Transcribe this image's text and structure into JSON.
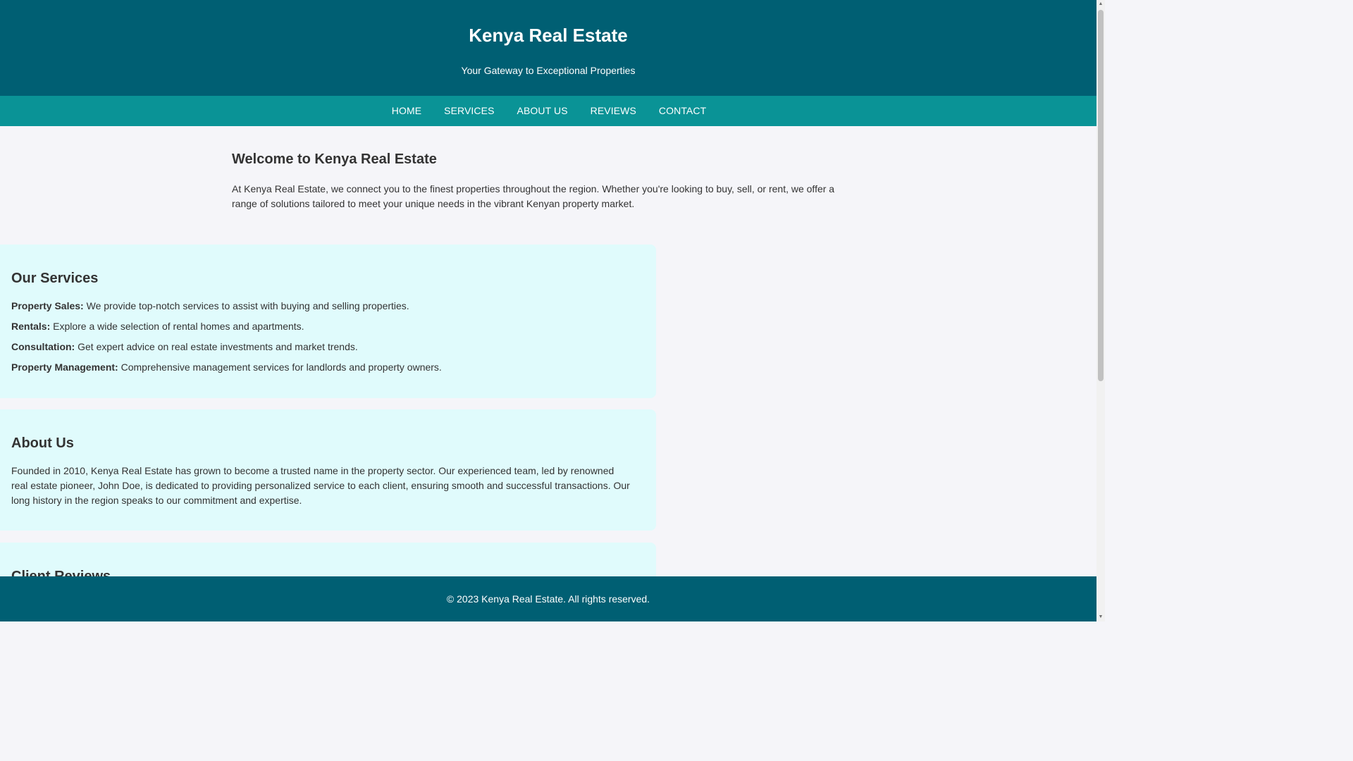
{
  "header": {
    "title": "Kenya Real Estate",
    "tagline": "Your Gateway to Exceptional Properties"
  },
  "nav": {
    "items": [
      {
        "label": "HOME"
      },
      {
        "label": "SERVICES"
      },
      {
        "label": "ABOUT US"
      },
      {
        "label": "REVIEWS"
      },
      {
        "label": "CONTACT"
      }
    ]
  },
  "welcome": {
    "heading": "Welcome to Kenya Real Estate",
    "text": "At Kenya Real Estate, we connect you to the finest properties throughout the region. Whether you're looking to buy, sell, or rent, we offer a range of solutions tailored to meet your unique needs in the vibrant Kenyan property market."
  },
  "services": {
    "heading": "Our Services",
    "items": [
      {
        "label": "Property Sales:",
        "text": " We provide top-notch services to assist with buying and selling properties."
      },
      {
        "label": "Rentals:",
        "text": " Explore a wide selection of rental homes and apartments."
      },
      {
        "label": "Consultation:",
        "text": " Get expert advice on real estate investments and market trends."
      },
      {
        "label": "Property Management:",
        "text": " Comprehensive management services for landlords and property owners."
      }
    ]
  },
  "about": {
    "heading": "About Us",
    "text": "Founded in 2010, Kenya Real Estate has grown to become a trusted name in the property sector. Our experienced team, led by renowned real estate pioneer, John Doe, is dedicated to providing personalized service to each client, ensuring smooth and successful transactions. Our long history in the region speaks to our commitment and expertise."
  },
  "reviews": {
    "heading": "Client Reviews"
  },
  "footer": {
    "text": "© 2023 Kenya Real Estate. All rights reserved."
  },
  "colors": {
    "header_bg": "#005f73",
    "nav_bg": "#0a9396",
    "card_bg": "#e0fbfc",
    "page_bg": "#f5f5f9"
  }
}
